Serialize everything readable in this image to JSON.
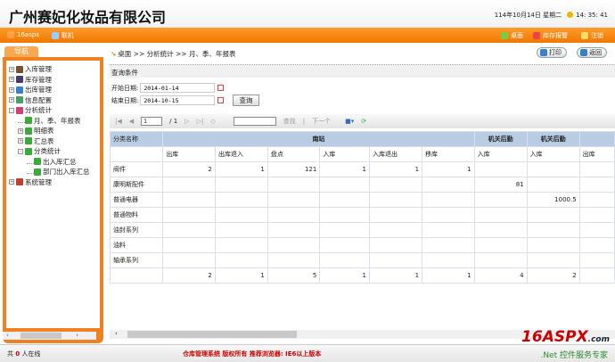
{
  "header": {
    "title": "广州赛妃化妆品有限公司",
    "date": "114年10月14日 星期二",
    "time": "14: 35: 41"
  },
  "topbar": {
    "user": "16aspx",
    "status": "联机",
    "desktop": "桌面",
    "stock_alarm": "库存报警",
    "logout": "注销"
  },
  "nav": {
    "tab": "导航",
    "items": [
      {
        "label": "入库管理",
        "level": 0,
        "pm": "+",
        "color": "#7a5030"
      },
      {
        "label": "库存管理",
        "level": 0,
        "pm": "+",
        "color": "#4a3a6a"
      },
      {
        "label": "出库管理",
        "level": 0,
        "pm": "+",
        "color": "#3a7fd0"
      },
      {
        "label": "信息配置",
        "level": 0,
        "pm": "+",
        "color": "#4a9a6a"
      },
      {
        "label": "分析统计",
        "level": 0,
        "pm": "-",
        "color": "#d04070"
      },
      {
        "label": "月、季、年报表",
        "level": 1,
        "pm": "",
        "color": "#3aaa3a"
      },
      {
        "label": "明细表",
        "level": 1,
        "pm": "+",
        "color": "#3aaa3a"
      },
      {
        "label": "汇总表",
        "level": 1,
        "pm": "+",
        "color": "#3aaa3a"
      },
      {
        "label": "分类统计",
        "level": 1,
        "pm": "-",
        "color": "#3aaa3a"
      },
      {
        "label": "出入库汇总",
        "level": 2,
        "pm": "",
        "color": "#3aaa3a"
      },
      {
        "label": "部门出入库汇总",
        "level": 2,
        "pm": "",
        "color": "#3aaa3a"
      },
      {
        "label": "系统管理",
        "level": 0,
        "pm": "+",
        "color": "#c04030"
      }
    ]
  },
  "breadcrumb": "桌面 >> 分析统计 >> 月、季、年报表",
  "buttons": {
    "print": "打印",
    "back": "返回"
  },
  "query": {
    "title": "查询条件",
    "start_label": "开始日期:",
    "start_value": "2014-01-14",
    "end_label": "结束日期:",
    "end_value": "2014-10-15",
    "submit": "查询"
  },
  "pager": {
    "page": "1",
    "total": "/ 1",
    "find": "查找",
    "next": "下一个"
  },
  "table": {
    "group_header": [
      "分类名称",
      "南站",
      "机关后勤",
      "机关后勤",
      ""
    ],
    "sub_header": [
      "",
      "出库",
      "出库退入",
      "盘点",
      "入库",
      "入库退出",
      "移库",
      "入库",
      "入库",
      "出库"
    ],
    "rows": [
      [
        "阀件",
        "2",
        "1",
        "121",
        "1",
        "1",
        "1",
        "",
        "",
        ""
      ],
      [
        "康明斯配件",
        "",
        "",
        "",
        "",
        "",
        "",
        "81",
        "",
        ""
      ],
      [
        "普通电器",
        "",
        "",
        "",
        "",
        "",
        "",
        "",
        "1000.5",
        ""
      ],
      [
        "普通物料",
        "",
        "",
        "",
        "",
        "",
        "",
        "",
        "",
        ""
      ],
      [
        "油封系列",
        "",
        "",
        "",
        "",
        "",
        "",
        "",
        "",
        ""
      ],
      [
        "油料",
        "",
        "",
        "",
        "",
        "",
        "",
        "",
        "",
        ""
      ],
      [
        "轴承系列",
        "",
        "",
        "",
        "",
        "",
        "",
        "",
        "",
        ""
      ],
      [
        "",
        "2",
        "1",
        "5",
        "1",
        "1",
        "1",
        "4",
        "2",
        ""
      ]
    ]
  },
  "footer": {
    "online_prefix": "共",
    "online_count": "0",
    "online_suffix": "人在线",
    "copyright": "仓库管理系统 版权所有 推荐浏览器: IE6以上版本",
    "logo": "16ASPX",
    "logo_suffix": ".com",
    "slogan": ".Net 控件服务专家"
  }
}
